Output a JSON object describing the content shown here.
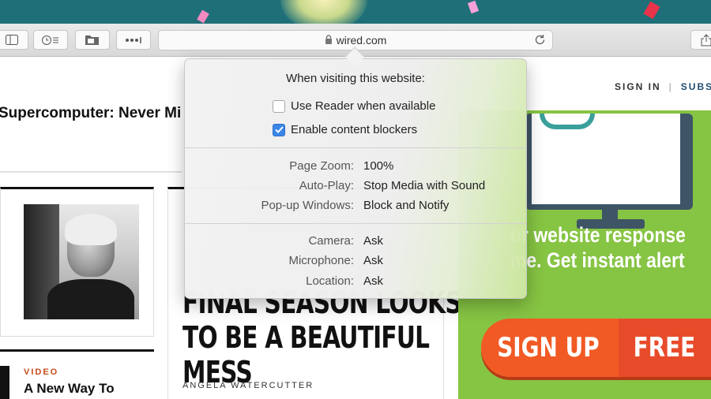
{
  "browser": {
    "url": "wired.com",
    "toolbar_icons": [
      "sidebar-icon",
      "history-icon",
      "downloads-icon",
      "more-icon",
      "lock-icon",
      "reload-icon",
      "share-icon"
    ]
  },
  "popover": {
    "title": "When visiting this website:",
    "reader_label": "Use Reader when available",
    "reader_checked": false,
    "blockers_label": "Enable content blockers",
    "blockers_checked": true,
    "settings": [
      {
        "label": "Page Zoom:",
        "value": "100%"
      },
      {
        "label": "Auto-Play:",
        "value": "Stop Media with Sound"
      },
      {
        "label": "Pop-up Windows:",
        "value": "Block and Notify"
      }
    ],
    "permissions": [
      {
        "label": "Camera:",
        "value": "Ask"
      },
      {
        "label": "Microphone:",
        "value": "Ask"
      },
      {
        "label": "Location:",
        "value": "Ask"
      }
    ]
  },
  "page": {
    "sign_in": "SIGN IN",
    "separator": "|",
    "subscribe": "SUBSC",
    "top_headline": "Supercomputer: Never Mi",
    "video_label": "VIDEO",
    "video_title": "A New Way To",
    "big_headline_lines": [
      "FINAL SEASON LOOKS",
      "TO BE A BEAUTIFUL",
      "MESS"
    ],
    "author": "ANGELA WATERCUTTER"
  },
  "ad": {
    "line1": "or website response",
    "line2": "me. Get instant alert",
    "signup_left": "SIGN UP",
    "signup_right": "FREE",
    "colors": {
      "background": "#86c443",
      "button_left": "#f15a24",
      "button_right": "#e84b2a"
    }
  },
  "colors": {
    "accent": "#3b86e8",
    "desktop": "#1e6f78"
  }
}
